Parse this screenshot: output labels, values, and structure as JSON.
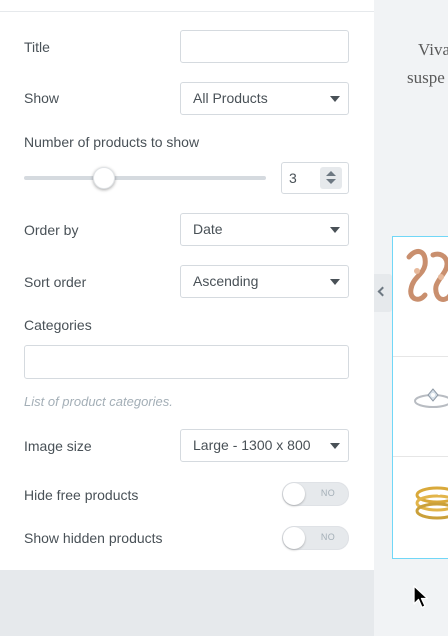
{
  "settings": {
    "title_label": "Title",
    "title_value": "",
    "show_label": "Show",
    "show_value": "All Products",
    "number_label": "Number of products to show",
    "number_value": "3",
    "number_slider_fraction": 0.33,
    "orderby_label": "Order by",
    "orderby_value": "Date",
    "sortorder_label": "Sort order",
    "sortorder_value": "Ascending",
    "categories_label": "Categories",
    "categories_value": "",
    "categories_hint": "List of product categories.",
    "imagesize_label": "Image size",
    "imagesize_value": "Large - 1300 x 800",
    "hide_free_label": "Hide free products",
    "hide_free_state": "NO",
    "show_hidden_label": "Show hidden products",
    "show_hidden_state": "NO"
  },
  "preview": {
    "text_line1": "Viva",
    "text_line2": "suspe",
    "products": [
      "earrings",
      "ring",
      "gold-rings"
    ]
  },
  "colors": {
    "accent_border": "#71d7f7",
    "panel_bg": "#ffffff",
    "panel_footer_bg": "#e6e9ec",
    "text": "#495157",
    "hint": "#a4afb7"
  }
}
